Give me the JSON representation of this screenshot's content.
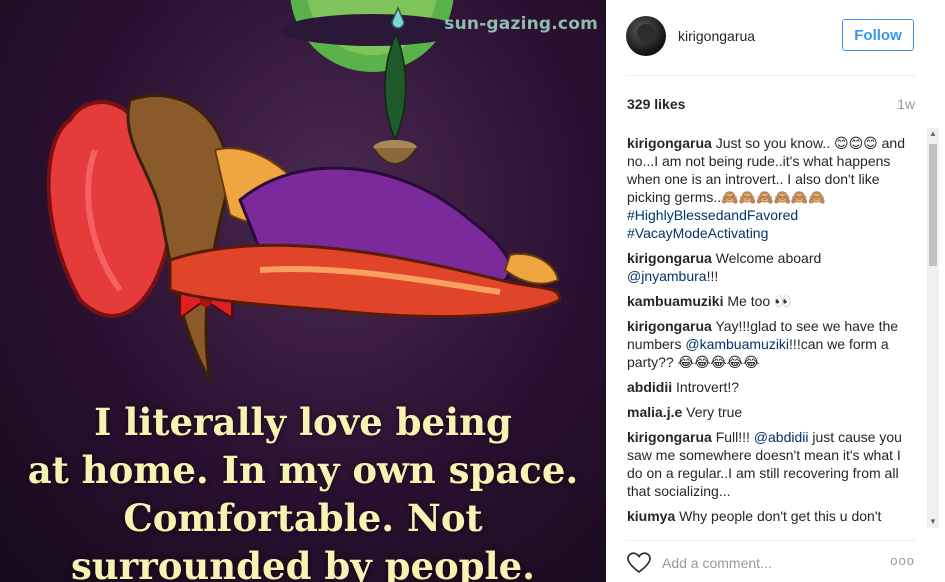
{
  "image": {
    "watermark": "sun-gazing.com",
    "quote_lines": [
      "I literally love being",
      "at home. In my own space.",
      "Comfortable. Not",
      "surrounded by people."
    ]
  },
  "post": {
    "username": "kirigongarua",
    "follow_label": "Follow",
    "likes": "329 likes",
    "age": "1w",
    "add_comment_placeholder": "Add a comment...",
    "more_label": "ooo"
  },
  "comments": [
    {
      "user": "kirigongarua",
      "text": "Just so you know.. 😊😊😊 and no...I am not being rude..it's what happens when one is an introvert.. I also don't like picking germs..🙈🙈🙈🙈🙈🙈",
      "tags": [
        "#HighlyBlessedandFavored",
        "#VacayModeActivating"
      ]
    },
    {
      "user": "kirigongarua",
      "text": "Welcome aboard",
      "mention": "@jnyambura",
      "after": "!!!"
    },
    {
      "user": "kambuamuziki",
      "text": "Me too 👀"
    },
    {
      "user": "kirigongarua",
      "text": "Yay!!!glad to see we have the numbers",
      "mention": "@kambuamuziki",
      "after": "!!!can we form a party?? 😂😂😂😂😂"
    },
    {
      "user": "abdidii",
      "text": "Introvert!?"
    },
    {
      "user": "malia.j.e",
      "text": "Very true"
    },
    {
      "user": "kirigongarua",
      "text": "Full!!!",
      "mention": "@abdidii",
      "after": "just cause you saw me somewhere doesn't mean it's what I do on a regular..I am still recovering from all that socializing..."
    },
    {
      "user": "kiumya",
      "text": "Why people don't get this u don't know"
    }
  ],
  "colors": {
    "accent": "#3897f0",
    "link": "#003569"
  }
}
